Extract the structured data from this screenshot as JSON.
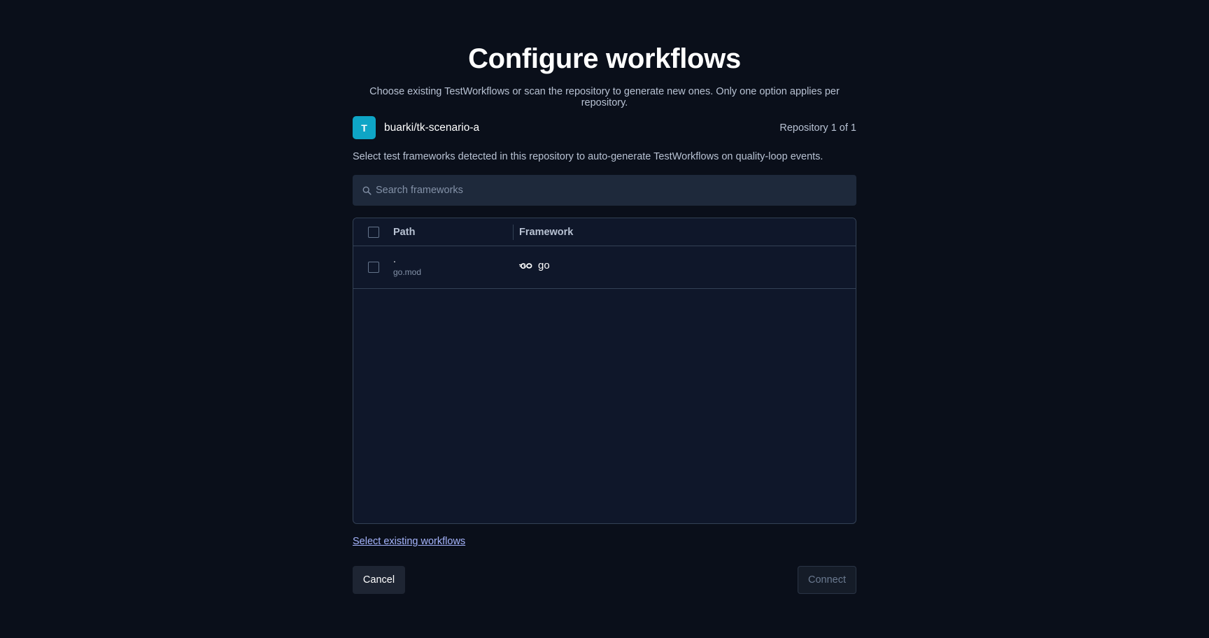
{
  "page": {
    "title": "Configure workflows",
    "subtitle": "Choose existing TestWorkflows or scan the repository to generate new ones. Only one option applies per repository."
  },
  "repository": {
    "avatar_letter": "T",
    "avatar_color": "#0ea5c6",
    "name": "buarki/tk-scenario-a",
    "counter": "Repository 1 of 1"
  },
  "hint": "Select test frameworks detected in this repository to auto-generate TestWorkflows on quality-loop events.",
  "search": {
    "placeholder": "Search frameworks",
    "value": "",
    "icon": "search-icon"
  },
  "table": {
    "columns": [
      "Path",
      "Framework"
    ],
    "rows": [
      {
        "path": ".",
        "file": "go.mod",
        "framework": "go",
        "framework_icon": "go-logo-icon",
        "checked": false
      }
    ]
  },
  "actions": {
    "select_existing": "Select existing workflows",
    "cancel": "Cancel",
    "connect": "Connect"
  },
  "colors": {
    "background": "#0a0f1a",
    "accent": "#0ea5c6",
    "link": "#a5b4fc"
  }
}
